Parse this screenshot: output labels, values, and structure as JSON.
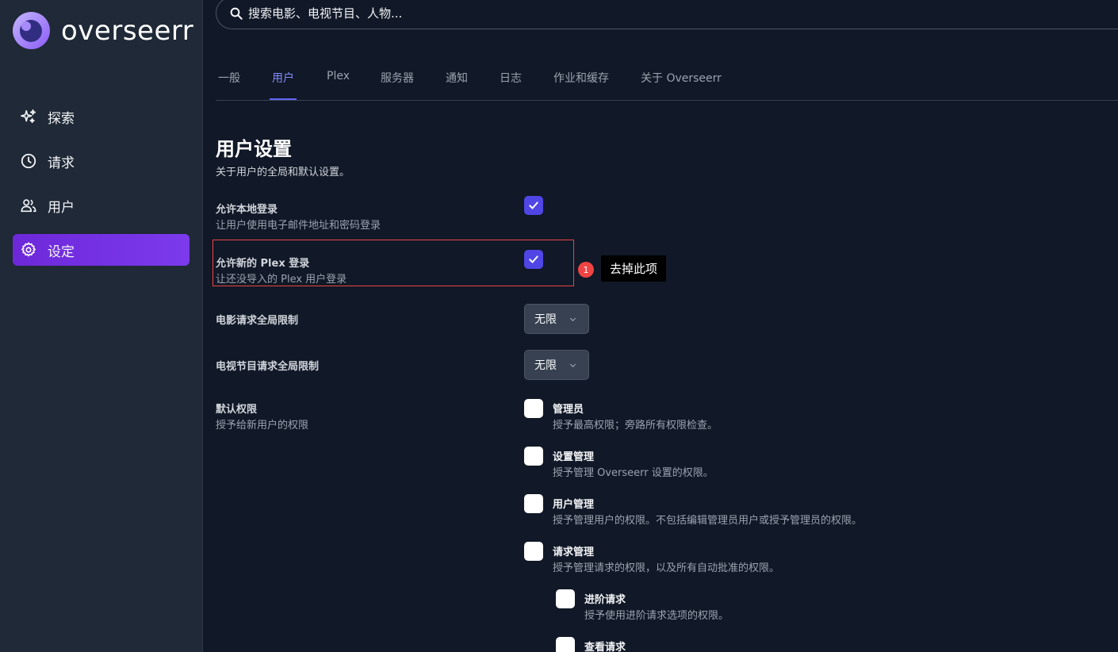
{
  "app": {
    "logo_text": "overseerr"
  },
  "sidebar": {
    "items": [
      {
        "label": "探索",
        "icon": "sparkles-icon"
      },
      {
        "label": "请求",
        "icon": "clock-icon"
      },
      {
        "label": "用户",
        "icon": "users-icon"
      },
      {
        "label": "设定",
        "icon": "gear-icon",
        "active": true
      }
    ]
  },
  "search": {
    "placeholder": "搜索电影、电视节目、人物..."
  },
  "tabs": [
    {
      "label": "一般"
    },
    {
      "label": "用户",
      "active": true
    },
    {
      "label": "Plex"
    },
    {
      "label": "服务器"
    },
    {
      "label": "通知"
    },
    {
      "label": "日志"
    },
    {
      "label": "作业和缓存"
    },
    {
      "label": "关于 Overseerr"
    }
  ],
  "page": {
    "title": "用户设置",
    "description": "关于用户的全局和默认设置。"
  },
  "settings": {
    "local_login": {
      "label": "允许本地登录",
      "desc": "让用户使用电子邮件地址和密码登录",
      "checked": true
    },
    "plex_login": {
      "label": "允许新的 Plex 登录",
      "desc": "让还没导入的 Plex 用户登录",
      "checked": true
    },
    "movie_limit": {
      "label": "电影请求全局限制",
      "value": "无限"
    },
    "tv_limit": {
      "label": "电视节目请求全局限制",
      "value": "无限"
    },
    "default_perms": {
      "label": "默认权限",
      "desc": "授予给新用户的权限"
    }
  },
  "annotation": {
    "badge": "1",
    "tooltip": "去掉此项"
  },
  "permissions": [
    {
      "title": "管理员",
      "desc": "授予最高权限；旁路所有权限检查。"
    },
    {
      "title": "设置管理",
      "desc": "授予管理 Overseerr 设置的权限。"
    },
    {
      "title": "用户管理",
      "desc": "授予管理用户的权限。不包括编辑管理员用户或授予管理员的权限。"
    },
    {
      "title": "请求管理",
      "desc": "授予管理请求的权限，以及所有自动批准的权限。"
    },
    {
      "title": "进阶请求",
      "desc": "授予使用进阶请求选项的权限。"
    },
    {
      "title": "查看请求",
      "desc": ""
    }
  ],
  "colors": {
    "accent": "#4f46e5",
    "active_nav": "#7c3aed",
    "highlight": "#ef4444"
  }
}
